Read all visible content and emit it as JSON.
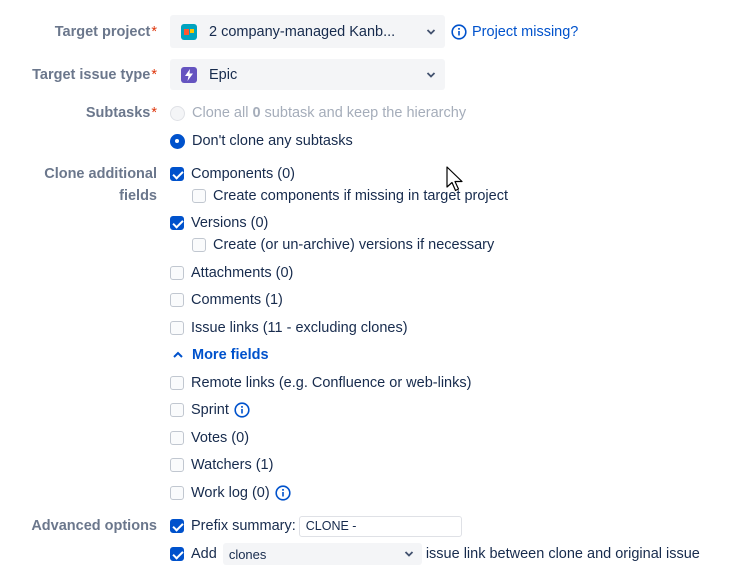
{
  "labels": {
    "target_project": "Target project",
    "target_issue_type": "Target issue type",
    "subtasks": "Subtasks",
    "clone_additional_fields_1": "Clone additional",
    "clone_additional_fields_2": "fields",
    "advanced_options": "Advanced options",
    "required_mark": "*"
  },
  "target_project": {
    "value": "2 company-managed Kanb...",
    "icon": "project-avatar-icon",
    "help_link": "Project missing?"
  },
  "target_issue_type": {
    "value": "Epic",
    "icon": "epic-lightning-icon"
  },
  "subtasks": {
    "options": [
      {
        "prefix": "Clone all ",
        "count": "0",
        "suffix": " subtask and keep the hierarchy",
        "selected": false,
        "disabled": true
      },
      {
        "label": "Don't clone any subtasks",
        "selected": true,
        "disabled": false
      }
    ]
  },
  "fields": {
    "components": {
      "label": "Components (0)",
      "checked": true
    },
    "create_components": {
      "label": "Create components if missing in target project",
      "checked": false
    },
    "versions": {
      "label": "Versions (0)",
      "checked": true
    },
    "create_versions": {
      "label": "Create (or un-archive) versions if necessary",
      "checked": false
    },
    "attachments": {
      "label": "Attachments (0)",
      "checked": false
    },
    "comments": {
      "label": "Comments (1)",
      "checked": false
    },
    "issue_links": {
      "label": "Issue links (11 - excluding clones)",
      "checked": false
    },
    "more_fields": "More fields",
    "remote_links": {
      "label": "Remote links (e.g. Confluence or web-links)",
      "checked": false
    },
    "sprint": {
      "label": "Sprint",
      "checked": false
    },
    "votes": {
      "label": "Votes (0)",
      "checked": false
    },
    "watchers": {
      "label": "Watchers (1)",
      "checked": false
    },
    "work_log": {
      "label": "Work log (0)",
      "checked": false
    }
  },
  "advanced": {
    "prefix_summary": {
      "label": "Prefix summary:",
      "checked": true,
      "value": "CLONE -"
    },
    "add_link": {
      "label": "Add",
      "checked": true,
      "link_type": "clones",
      "suffix": "issue link between clone and original issue"
    }
  },
  "colors": {
    "accent": "#0052cc",
    "label_gray": "#6b778c",
    "required": "#de350b",
    "select_bg": "#f4f5f7",
    "epic": "#6554c0"
  }
}
